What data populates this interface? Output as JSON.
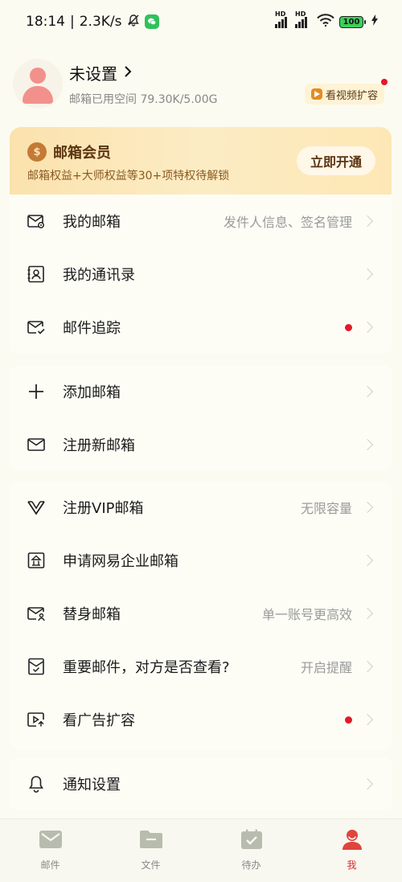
{
  "status_bar": {
    "time": "18:14",
    "separator": "|",
    "net_speed": "2.3K/s",
    "battery": "100"
  },
  "profile": {
    "name": "未设置",
    "storage": "邮箱已用空间 79.30K/5.00G",
    "video_expand": "看视频扩容"
  },
  "vip": {
    "title": "邮箱会员",
    "subtitle": "邮箱权益+大师权益等30+项特权待解锁",
    "button": "立即开通",
    "coin_symbol": "$"
  },
  "menu": {
    "my_mailbox": {
      "label": "我的邮箱",
      "value": "发件人信息、签名管理"
    },
    "contacts": {
      "label": "我的通讯录"
    },
    "mail_tracking": {
      "label": "邮件追踪"
    },
    "add_mailbox": {
      "label": "添加邮箱"
    },
    "register_new": {
      "label": "注册新邮箱"
    },
    "register_vip": {
      "label": "注册VIP邮箱",
      "value": "无限容量"
    },
    "enterprise": {
      "label": "申请网易企业邮箱"
    },
    "alias": {
      "label": "替身邮箱",
      "value": "单一账号更高效"
    },
    "read_receipt": {
      "label": "重要邮件，对方是否查看?",
      "value": "开启提醒"
    },
    "ad_expand": {
      "label": "看广告扩容"
    },
    "notifications": {
      "label": "通知设置"
    }
  },
  "tabs": [
    {
      "label": "邮件",
      "icon": "mail-icon"
    },
    {
      "label": "文件",
      "icon": "folder-icon"
    },
    {
      "label": "待办",
      "icon": "calendar-check-icon"
    },
    {
      "label": "我",
      "icon": "person-icon"
    }
  ],
  "colors": {
    "background": "#fcfbf1",
    "accent": "#d92b2b",
    "vip_text": "#5b3410",
    "red_dot": "#e3192b"
  }
}
